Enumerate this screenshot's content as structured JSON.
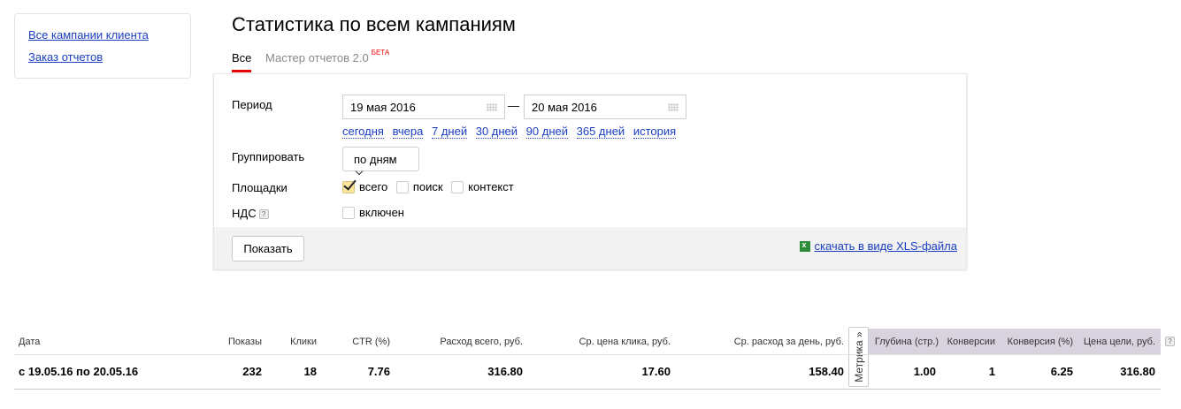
{
  "sidebar": {
    "links": [
      "Все кампании клиента",
      "Заказ отчетов"
    ]
  },
  "page_title": "Статистика по всем кампаниям",
  "tabs": [
    {
      "label": "Все",
      "active": true
    },
    {
      "label": "Мастер отчетов 2.0",
      "badge": "БЕТА"
    }
  ],
  "form": {
    "period_label": "Период",
    "date_from": "19 мая 2016",
    "date_sep": "—",
    "date_to": "20 мая 2016",
    "quick_links": [
      "сегодня",
      "вчера",
      "7 дней",
      "30 дней",
      "90 дней",
      "365 дней",
      "история"
    ],
    "group_label": "Группировать",
    "group_value": "по дням",
    "platforms_label": "Площадки",
    "platforms": [
      {
        "label": "всего",
        "checked": true
      },
      {
        "label": "поиск",
        "checked": false
      },
      {
        "label": "контекст",
        "checked": false
      }
    ],
    "vat_label": "НДС",
    "help": "?",
    "vat_option": "включен",
    "vat_checked": false,
    "show_button": "Показать",
    "xls_link": "скачать в виде XLS-файла"
  },
  "table": {
    "headers": [
      "Дата",
      "Показы",
      "Клики",
      "CTR (%)",
      "Расход всего, руб.",
      "Ср. цена клика, руб.",
      "Ср. расход за день, руб.",
      "Глубина (стр.)",
      "Конверсии",
      "Конверсия (%)",
      "Цена цели, руб."
    ],
    "metrika_tab": "Метрика »",
    "help": "?",
    "rows": [
      [
        "с 19.05.16 по 20.05.16",
        "232",
        "18",
        "7.76",
        "316.80",
        "17.60",
        "158.40",
        "1.00",
        "1",
        "6.25",
        "316.80"
      ]
    ]
  },
  "colors": {
    "link": "#1a3dc1",
    "accent": "#e60000",
    "metrika_bg": "#d9d3df"
  }
}
